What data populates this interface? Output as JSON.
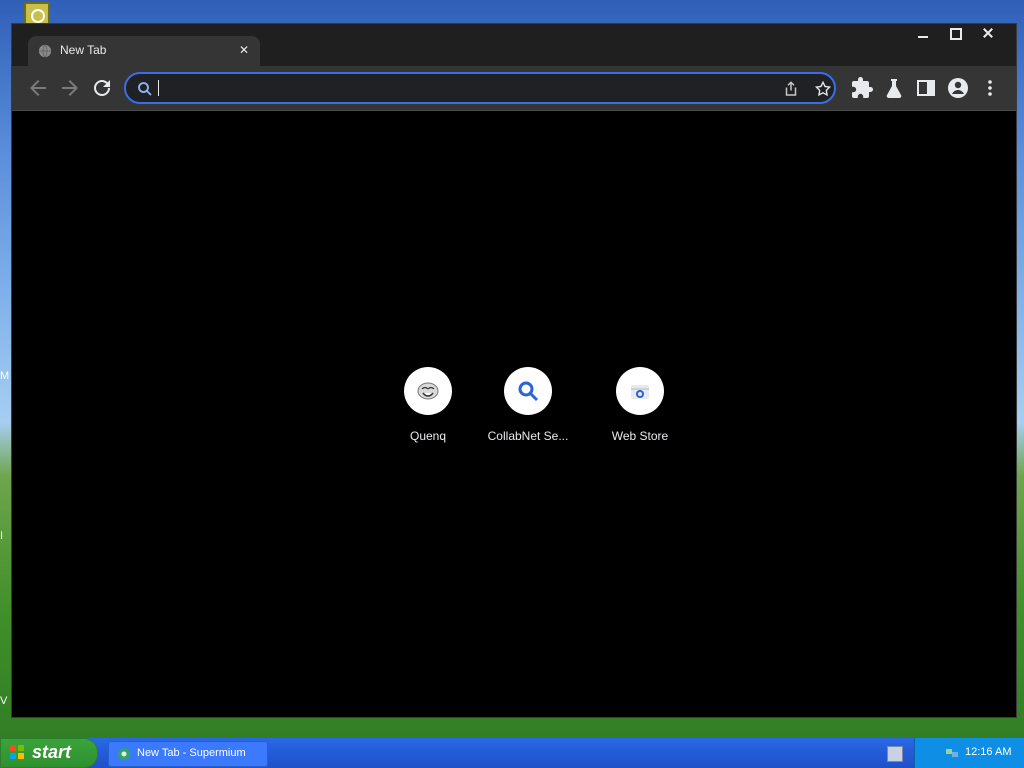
{
  "desktop": {
    "left_labels": [
      "M",
      "I",
      "V"
    ]
  },
  "browser": {
    "tab": {
      "title": "New Tab"
    },
    "omnibox": {
      "value": ""
    },
    "shortcuts": [
      {
        "label": "Quenq",
        "icon": "troll-face-icon"
      },
      {
        "label": "CollabNet Se...",
        "icon": "search-icon"
      },
      {
        "label": "Web Store",
        "icon": "web-store-icon"
      }
    ]
  },
  "taskbar": {
    "start_label": "start",
    "task_item": {
      "title": "New Tab - Supermium"
    },
    "clock": "12:16 AM"
  },
  "colors": {
    "omnibox_border": "#3b6ee6",
    "toolbar_bg": "#353535",
    "titlebar_bg": "#1f1f1f",
    "page_bg": "#000000"
  }
}
